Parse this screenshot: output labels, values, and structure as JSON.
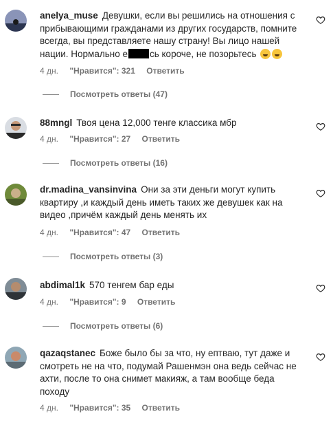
{
  "comments": [
    {
      "username": "anelya_muse",
      "text_before": "Девушки, если вы решились на отношения с прибывающими гражданами из других государств, помните всегда, вы представляете нашу страну! Вы лицо нашей нации. Нормально е",
      "text_after": "сь короче, не позорьтесь",
      "time": "4 дн.",
      "likes": "\"Нравится\": 321",
      "reply": "Ответить",
      "view_replies": "Посмотреть ответы (47)",
      "avatar_colors": [
        "#8a94b8",
        "#2c3550"
      ],
      "icons": [
        "laughing-emoji-icon",
        "rofl-emoji-icon"
      ]
    },
    {
      "username": "88mngl",
      "text": "Твоя цена 12,000 тенге классика мбр",
      "time": "4 дн.",
      "likes": "\"Нравится\": 27",
      "reply": "Ответить",
      "view_replies": "Посмотреть ответы (16)",
      "avatar_colors": [
        "#d9dde3",
        "#2a2a2a"
      ]
    },
    {
      "username": "dr.madina_vansinvina",
      "text": "Они за эти деньги могут купить квартиру ,и каждый день иметь таких же девушек как на видео ,причём каждый день менять их",
      "time": "4 дн.",
      "likes": "\"Нравится\": 47",
      "reply": "Ответить",
      "view_replies": "Посмотреть ответы (3)",
      "avatar_colors": [
        "#6f8a3a",
        "#c9b08a"
      ]
    },
    {
      "username": "abdimal1k",
      "text": "570 тенгем бар еды",
      "time": "4 дн.",
      "likes": "\"Нравится\": 9",
      "reply": "Ответить",
      "view_replies": "Посмотреть ответы (6)",
      "avatar_colors": [
        "#7f8c96",
        "#2e3338"
      ]
    },
    {
      "username": "qazaqstanec",
      "text": "Боже было бы за что, ну ептваю, тут даже и смотреть не на что, подумай Рашенмэн она ведь сейчас не ахти, после то она снимет макияж, а там вообще беда походу",
      "time": "4 дн.",
      "likes": "\"Нравится\": 35",
      "reply": "Ответить",
      "avatar_colors": [
        "#8fa7b5",
        "#c98a6a"
      ]
    }
  ]
}
